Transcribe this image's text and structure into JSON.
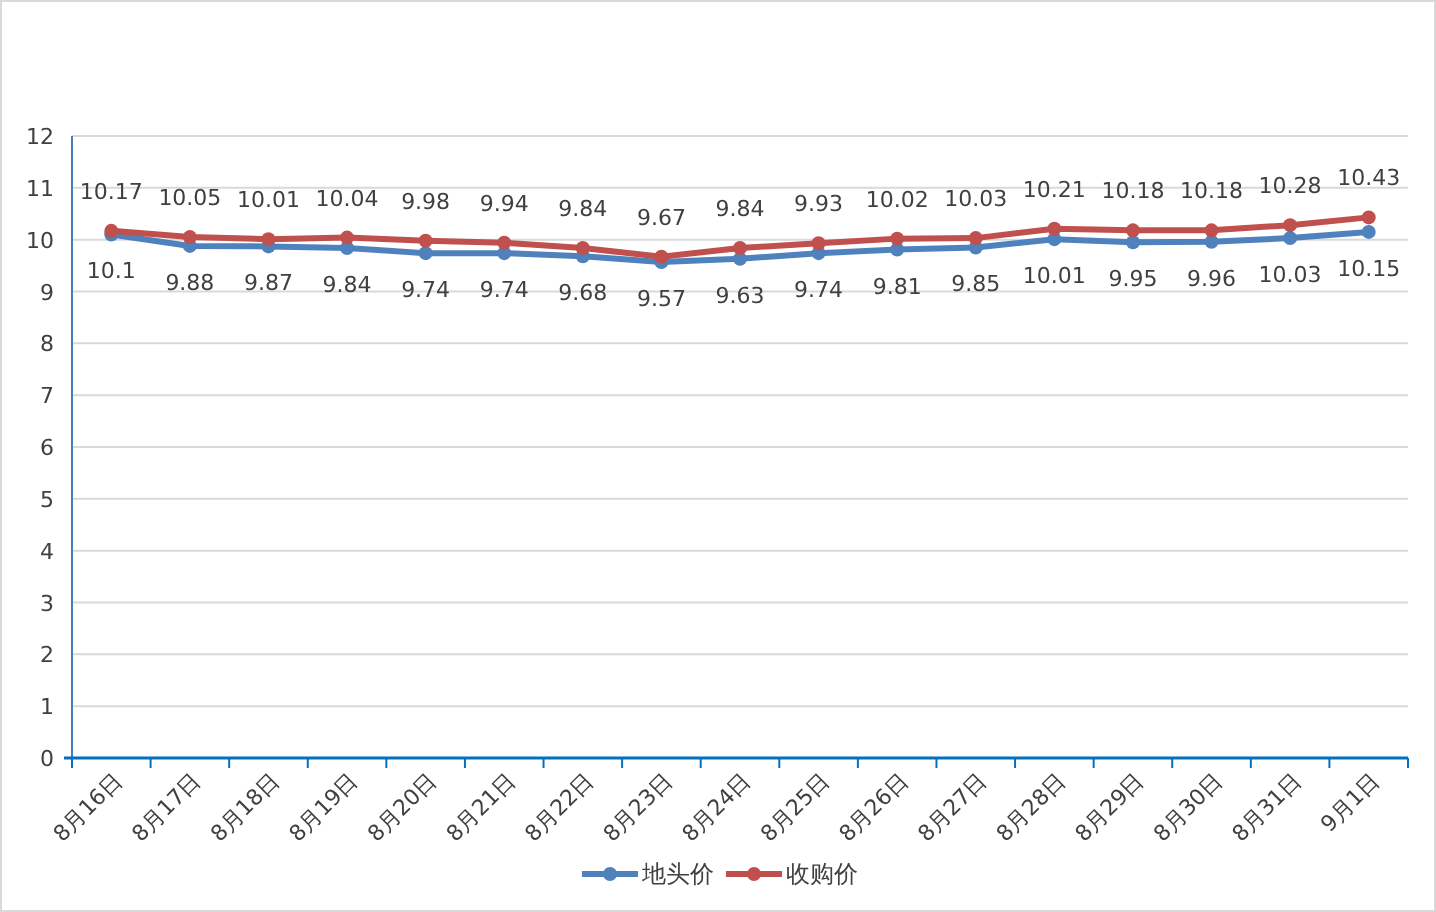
{
  "chart_data": {
    "type": "line",
    "categories": [
      "8月16日",
      "8月17日",
      "8月18日",
      "8月19日",
      "8月20日",
      "8月21日",
      "8月22日",
      "8月23日",
      "8月24日",
      "8月25日",
      "8月26日",
      "8月27日",
      "8月28日",
      "8月29日",
      "8月30日",
      "8月31日",
      "9月1日"
    ],
    "series": [
      {
        "name": "地头价",
        "color": "#4f81bd",
        "marker": "circle",
        "values": [
          10.1,
          9.88,
          9.87,
          9.84,
          9.74,
          9.74,
          9.68,
          9.57,
          9.63,
          9.74,
          9.81,
          9.85,
          10.01,
          9.95,
          9.96,
          10.03,
          10.15
        ]
      },
      {
        "name": "收购价",
        "color": "#c0504d",
        "marker": "circle",
        "values": [
          10.17,
          10.05,
          10.01,
          10.04,
          9.98,
          9.94,
          9.84,
          9.67,
          9.84,
          9.93,
          10.02,
          10.03,
          10.21,
          10.18,
          10.18,
          10.28,
          10.43
        ]
      }
    ],
    "ylim": [
      0,
      12
    ],
    "yticks": [
      0,
      1,
      2,
      3,
      4,
      5,
      6,
      7,
      8,
      9,
      10,
      11,
      12
    ],
    "data_labels": true,
    "grid": true,
    "legend": true
  }
}
